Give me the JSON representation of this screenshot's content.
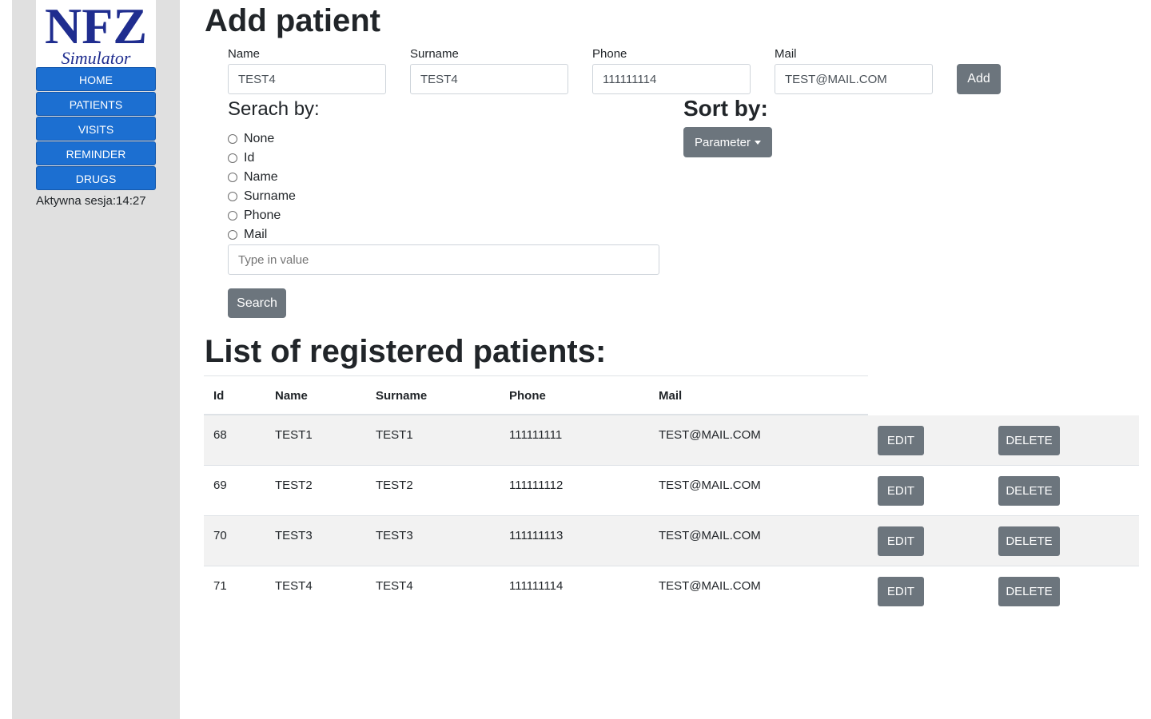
{
  "sidebar": {
    "logo": {
      "main_text": "NFZ",
      "sub_text": "Simulator",
      "color": "#1f2d8f"
    },
    "nav": [
      {
        "label": "HOME"
      },
      {
        "label": "PATIENTS"
      },
      {
        "label": "VISITS"
      },
      {
        "label": "REMINDER"
      },
      {
        "label": "DRUGS"
      }
    ],
    "session_label": "Aktywna sesja:",
    "session_time": "14:27",
    "nav_color": "#1c6fd1",
    "background": "#e0e0e0"
  },
  "add_patient": {
    "title": "Add patient",
    "fields": [
      {
        "label": "Name",
        "value": "TEST4"
      },
      {
        "label": "Surname",
        "value": "TEST4"
      },
      {
        "label": "Phone",
        "value": "111111114"
      },
      {
        "label": "Mail",
        "value": "TEST@MAIL.COM"
      }
    ],
    "add_label": "Add"
  },
  "search": {
    "title": "Serach by:",
    "options": [
      "None",
      "Id",
      "Name",
      "Surname",
      "Phone",
      "Mail"
    ],
    "placeholder": "Type in value",
    "button_label": "Search"
  },
  "sort": {
    "title": "Sort by:",
    "dropdown_label": "Parameter"
  },
  "list": {
    "title": "List of registered patients:",
    "columns": [
      "Id",
      "Name",
      "Surname",
      "Phone",
      "Mail"
    ],
    "edit_label": "EDIT",
    "delete_label": "DELETE",
    "rows": [
      {
        "id": "68",
        "name": "TEST1",
        "surname": "TEST1",
        "phone": "111111111",
        "mail": "TEST@MAIL.COM"
      },
      {
        "id": "69",
        "name": "TEST2",
        "surname": "TEST2",
        "phone": "111111112",
        "mail": "TEST@MAIL.COM"
      },
      {
        "id": "70",
        "name": "TEST3",
        "surname": "TEST3",
        "phone": "111111113",
        "mail": "TEST@MAIL.COM"
      },
      {
        "id": "71",
        "name": "TEST4",
        "surname": "TEST4",
        "phone": "111111114",
        "mail": "TEST@MAIL.COM"
      }
    ]
  },
  "colors": {
    "button_gray": "#6c757d",
    "stripe": "#f2f2f2"
  }
}
